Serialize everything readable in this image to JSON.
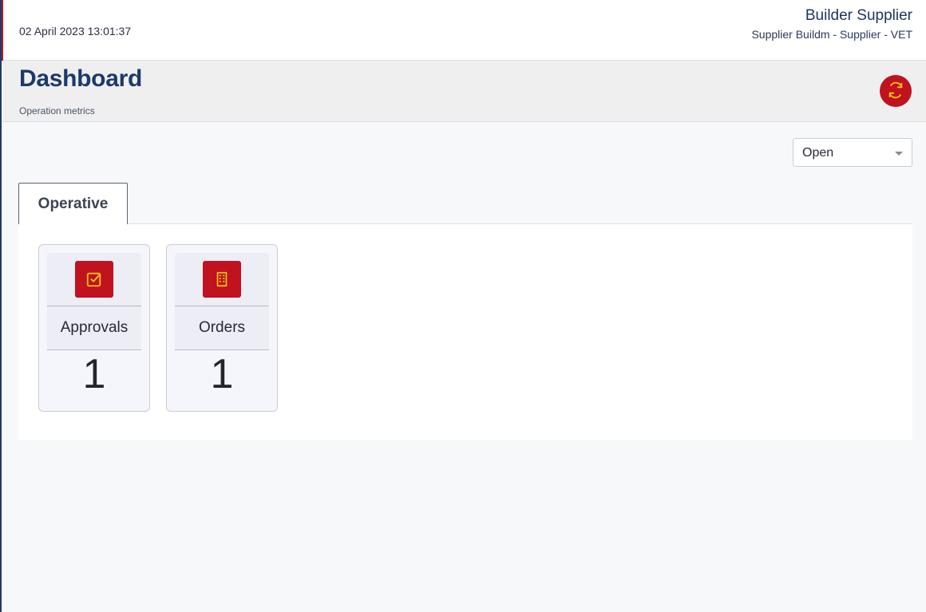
{
  "header": {
    "datetime": "02 April 2023 13:01:37",
    "user_name": "Builder Supplier",
    "user_role": "Supplier Buildm - Supplier - VET"
  },
  "page": {
    "title": "Dashboard",
    "subtitle": "Operation metrics",
    "refresh_icon": "refresh-icon"
  },
  "filter": {
    "selected": "Open"
  },
  "tabs": [
    {
      "label": "Operative",
      "active": true
    }
  ],
  "cards": [
    {
      "label": "Approvals",
      "value": "1",
      "icon": "checkbox-icon"
    },
    {
      "label": "Orders",
      "value": "1",
      "icon": "building-icon"
    }
  ],
  "colors": {
    "brand_red": "#c0121f",
    "icon_yellow": "#f5c518",
    "title_navy": "#1b3a6b"
  }
}
